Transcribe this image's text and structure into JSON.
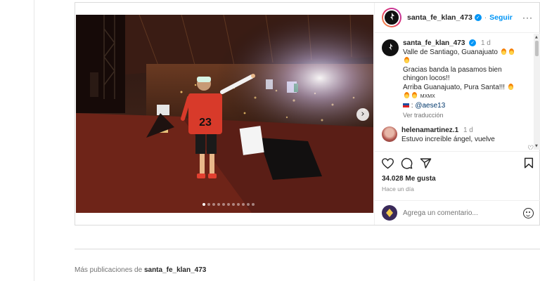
{
  "post": {
    "username": "santa_fe_klan_473",
    "follow_label": "Seguir",
    "more_label": "···",
    "media": {
      "jersey_number": "23",
      "slide_count": 11,
      "active_slide": 1,
      "next_label": "›"
    },
    "caption": {
      "username": "santa_fe_klan_473",
      "time": "1 d",
      "line1": "Valle de Santiago, Guanajuato",
      "line2": "Gracias banda la pasamos bien",
      "line3": "chingon locos!!",
      "line4": "Arriba Guanajuato, Pura Santa!!!",
      "line5": "MXMX",
      "mention": "@aese13",
      "mention_prefix": ":",
      "translate_label": "Ver traducción"
    },
    "comment": {
      "username": "helenamartinez.1",
      "time": "1 d",
      "text": "Estuvo increíble ángel, vuelve"
    },
    "likes": "34.028 Me gusta",
    "posted": "Hace un día",
    "comment_placeholder": "Agrega un comentario..."
  },
  "more_posts": {
    "prefix": "Más publicaciones de",
    "username": "santa_fe_klan_473"
  },
  "colors": {
    "accent": "#0095f6",
    "link": "#00376b",
    "muted": "#8e8e8e"
  },
  "icons": [
    "heart-icon",
    "comment-icon",
    "share-icon",
    "bookmark-icon",
    "emoji-icon",
    "verified-icon",
    "more-icon"
  ]
}
